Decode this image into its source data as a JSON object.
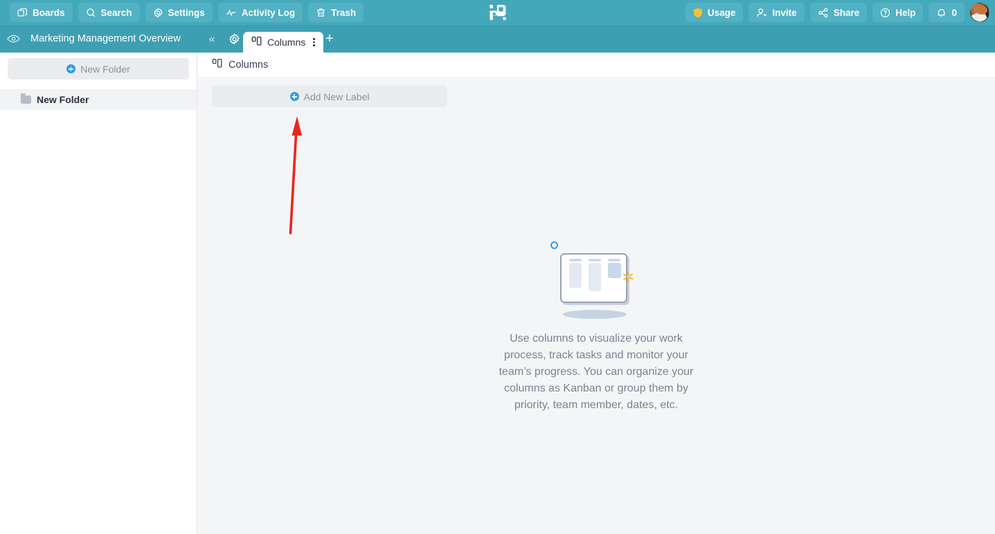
{
  "colors": {
    "topbar_teal": "#44a8bb",
    "subbar_teal": "#3f9fb2",
    "button_teal": "#52b1c2",
    "accent_blue": "#2d9cf0",
    "content_bg": "#f4f5f7",
    "annotation_red": "#e8271d",
    "sparkle_yellow": "#f5b229",
    "usage_badge_yellow": "#f5c033"
  },
  "topbar": {
    "left_buttons": [
      {
        "label": "Boards",
        "icon": "boards-icon"
      },
      {
        "label": "Search",
        "icon": "search-icon"
      },
      {
        "label": "Settings",
        "icon": "gear-icon"
      },
      {
        "label": "Activity Log",
        "icon": "activity-icon"
      },
      {
        "label": "Trash",
        "icon": "trash-icon"
      }
    ],
    "logo": "app-logo",
    "right_buttons": [
      {
        "label": "Usage",
        "icon": "shield-icon"
      },
      {
        "label": "Invite",
        "icon": "user-add-icon"
      },
      {
        "label": "Share",
        "icon": "share-icon"
      },
      {
        "label": "Help",
        "icon": "question-circle-icon"
      },
      {
        "label": "0",
        "icon": "bell-icon"
      }
    ],
    "avatar": "user-avatar"
  },
  "subbar": {
    "eye_icon": "eye-icon",
    "board_title": "Marketing Management Overview",
    "collapse_icon": "«",
    "gear_icon": "gear-icon",
    "tab": {
      "label": "Columns",
      "icon": "columns-icon",
      "menu_icon": "kebab-menu-icon"
    },
    "add_tab_label": "+"
  },
  "sidebar": {
    "new_folder_button": "New Folder",
    "folders": [
      {
        "label": "New Folder",
        "selected": true
      }
    ]
  },
  "main": {
    "header": {
      "title": "Columns",
      "icon": "columns-icon"
    },
    "add_new_label_button": "Add New Label",
    "empty_state": {
      "illustration": "columns-board-illustration",
      "text": "Use columns to visualize your work process, track tasks and monitor your team’s progress. You can organize your columns as Kanban or group them by priority, team member, dates, etc."
    }
  },
  "annotation": {
    "arrow": "red-arrow-pointing-to-add-new-label",
    "from": "419,337",
    "to": "429,172"
  }
}
